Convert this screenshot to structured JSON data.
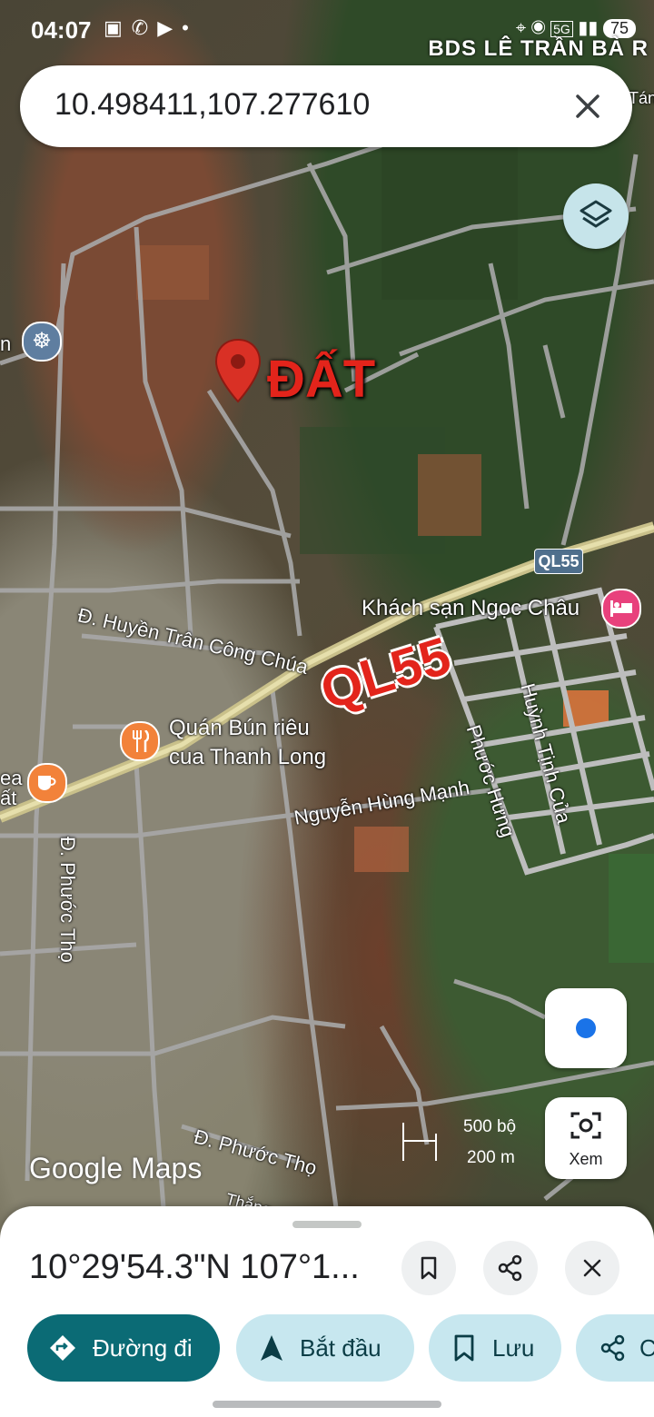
{
  "status_bar": {
    "time": "04:07",
    "left_icons": [
      "screen-record-icon",
      "missed-call-icon",
      "youtube-icon",
      "dot-icon"
    ],
    "right_icons": [
      "location-icon",
      "hotspot-icon",
      "5g-icon",
      "signal-icon"
    ],
    "battery": "75"
  },
  "watermark": "BDS LÊ TRẦN BÀ R",
  "search": {
    "query": "10.498411,107.277610"
  },
  "map": {
    "marker_label": "ĐẤT",
    "highway_label": "QL55",
    "route_shield": "QL55",
    "streets": [
      "Đ. Huyền Trân Công Chúa",
      "Đ. Phước Thọ",
      "Nguyễn Hùng Mạnh",
      "Phước Hưng",
      "Huỳnh Tịnh Của",
      "Đ. Phước Thọ"
    ],
    "pois": [
      {
        "name": "Khách sạn Ngọc Châu",
        "icon": "hotel-icon",
        "color": "#e8417c"
      },
      {
        "name_line1": "Quán Bún riêu",
        "name_line2": "cua Thanh Long",
        "icon": "restaurant-icon",
        "color": "#f2823a"
      },
      {
        "name_line1": "ea",
        "name_line2": "ất",
        "icon": "coffee-icon",
        "color": "#f2823a"
      },
      {
        "name": "n",
        "icon": "temple-icon",
        "color": "#5f7ea0"
      }
    ],
    "edge_labels": {
      "top_right": "Tán",
      "bottom": "Thắng"
    },
    "scale": {
      "imperial": "500 bộ",
      "metric": "200 m"
    },
    "logo": "Google Maps"
  },
  "controls": {
    "xem_label": "Xem"
  },
  "sheet": {
    "coords": "10°29'54.3\"N 107°1...",
    "actions": {
      "directions": "Đường đi",
      "start": "Bắt đầu",
      "save": "Lưu",
      "share_partial": "C"
    }
  },
  "colors": {
    "primary": "#0b6b75",
    "chip_bg": "#c7e7ef",
    "marker_red": "#d93025",
    "hotel_pink": "#e8417c",
    "food_orange": "#f2823a"
  }
}
